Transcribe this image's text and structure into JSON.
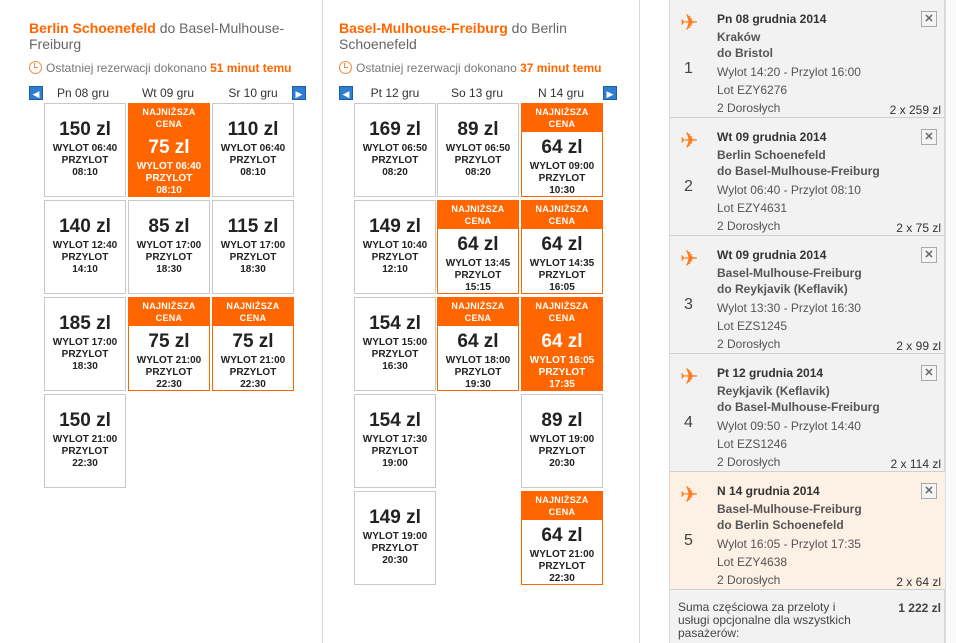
{
  "outbound": {
    "city": "Berlin Schoenefeld",
    "rest": " do Basel-Mulhouse-Freiburg",
    "booked_prefix": "Ostatniej rezerwacji dokonano ",
    "booked_mins": "51 minut temu",
    "prev_arrow": "◀",
    "next_arrow": "▶",
    "days": [
      "Pn 08 gru",
      "Wt 09 gru",
      "Sr 10 gru"
    ],
    "columns": [
      [
        {
          "price": "150 zl",
          "dep": "WYLOT 06:40",
          "arr_label": "PRZYLOT",
          "arr": "08:10"
        },
        {
          "price": "140 zl",
          "dep": "WYLOT 12:40",
          "arr_label": "PRZYLOT",
          "arr": "14:10"
        },
        {
          "price": "185 zl",
          "dep": "WYLOT 17:00",
          "arr_label": "PRZYLOT",
          "arr": "18:30"
        },
        {
          "price": "150 zl",
          "dep": "WYLOT 21:00",
          "arr_label": "PRZYLOT",
          "arr": "22:30"
        }
      ],
      [
        {
          "badge": "NAJNIŻSZA\nCENA",
          "price": "75 zl",
          "dep": "WYLOT 06:40",
          "arr_label": "PRZYLOT",
          "arr": "08:10"
        },
        {
          "price": "85 zl",
          "dep": "WYLOT 17:00",
          "arr_label": "PRZYLOT",
          "arr": "18:30"
        },
        {
          "badge": "NAJNIŻSZA\nCENA",
          "price": "75 zl",
          "dep": "WYLOT 21:00",
          "arr_label": "PRZYLOT",
          "arr": "22:30"
        }
      ],
      [
        {
          "price": "110 zl",
          "dep": "WYLOT 06:40",
          "arr_label": "PRZYLOT",
          "arr": "08:10"
        },
        {
          "price": "115 zl",
          "dep": "WYLOT 17:00",
          "arr_label": "PRZYLOT",
          "arr": "18:30"
        },
        {
          "badge": "NAJNIŻSZA\nCENA",
          "price": "75 zl",
          "dep": "WYLOT 21:00",
          "arr_label": "PRZYLOT",
          "arr": "22:30"
        }
      ]
    ]
  },
  "return": {
    "city": "Basel-Mulhouse-Freiburg",
    "rest": " do Berlin Schoenefeld",
    "booked_prefix": "Ostatniej rezerwacji dokonano ",
    "booked_mins": "37 minut temu",
    "prev_arrow": "◀",
    "next_arrow": "▶",
    "days": [
      "Pt 12 gru",
      "So 13 gru",
      "N 14 gru"
    ],
    "columns": [
      [
        {
          "price": "169 zl",
          "dep": "WYLOT 06:50",
          "arr_label": "PRZYLOT",
          "arr": "08:20"
        },
        {
          "price": "149 zl",
          "dep": "WYLOT 10:40",
          "arr_label": "PRZYLOT",
          "arr": "12:10"
        },
        {
          "price": "154 zl",
          "dep": "WYLOT 15:00",
          "arr_label": "PRZYLOT",
          "arr": "16:30"
        },
        {
          "price": "154 zl",
          "dep": "WYLOT 17:30",
          "arr_label": "PRZYLOT",
          "arr": "19:00"
        },
        {
          "price": "149 zl",
          "dep": "WYLOT 19:00",
          "arr_label": "PRZYLOT",
          "arr": "20:30"
        }
      ],
      [
        {
          "price": "89 zl",
          "dep": "WYLOT 06:50",
          "arr_label": "PRZYLOT",
          "arr": "08:20"
        },
        {
          "badge": "NAJNIŻSZA\nCENA",
          "price": "64 zl",
          "dep": "WYLOT 13:45",
          "arr_label": "PRZYLOT",
          "arr": "15:15"
        },
        {
          "badge": "NAJNIŻSZA\nCENA",
          "price": "64 zl",
          "dep": "WYLOT 18:00",
          "arr_label": "PRZYLOT",
          "arr": "19:30"
        }
      ],
      [
        {
          "badge": "NAJNIŻSZA\nCENA",
          "price": "64 zl",
          "dep": "WYLOT 09:00",
          "arr_label": "PRZYLOT",
          "arr": "10:30"
        },
        {
          "badge": "NAJNIŻSZA\nCENA",
          "price": "64 zl",
          "dep": "WYLOT 14:35",
          "arr_label": "PRZYLOT",
          "arr": "16:05"
        },
        {
          "badge": "NAJNIŻSZA\nCENA",
          "price": "64 zl",
          "dep": "WYLOT 16:05",
          "arr_label": "PRZYLOT",
          "arr": "17:35"
        },
        {
          "price": "89 zl",
          "dep": "WYLOT 19:00",
          "arr_label": "PRZYLOT",
          "arr": "20:30"
        },
        {
          "badge": "NAJNIŻSZA\nCENA",
          "price": "64 zl",
          "dep": "WYLOT 21:00",
          "arr_label": "PRZYLOT",
          "arr": "22:30"
        }
      ]
    ]
  },
  "basket": {
    "segments": [
      {
        "num": "1",
        "date": "Pn 08 grudnia 2014",
        "from": "Kraków",
        "to": "do Bristol",
        "times": "Wylot 14:20 - Przylot 16:00",
        "flight": "Lot EZY6276",
        "pax": "2 Dorosłych",
        "amount": "2 x 259 zl"
      },
      {
        "num": "2",
        "date": "Wt 09 grudnia 2014",
        "from": "Berlin Schoenefeld",
        "to": "do Basel-Mulhouse-Freiburg",
        "times": "Wylot 06:40 - Przylot 08:10",
        "flight": "Lot EZY4631",
        "pax": "2 Dorosłych",
        "amount": "2 x 75 zl"
      },
      {
        "num": "3",
        "date": "Wt 09 grudnia 2014",
        "from": "Basel-Mulhouse-Freiburg",
        "to": "do Reykjavik (Keflavik)",
        "times": "Wylot 13:30 - Przylot 16:30",
        "flight": "Lot EZS1245",
        "pax": "2 Dorosłych",
        "amount": "2 x 99 zl"
      },
      {
        "num": "4",
        "date": "Pt 12 grudnia 2014",
        "from": "Reykjavik (Keflavik)",
        "to": "do Basel-Mulhouse-Freiburg",
        "times": "Wylot 09:50 - Przylot 14:40",
        "flight": "Lot EZS1246",
        "pax": "2 Dorosłych",
        "amount": "2 x 114 zl"
      },
      {
        "num": "5",
        "date": "N 14 grudnia 2014",
        "from": "Basel-Mulhouse-Freiburg",
        "to": "do Berlin Schoenefeld",
        "times": "Wylot 16:05 - Przylot 17:35",
        "flight": "Lot EZY4638",
        "pax": "2 Dorosłych",
        "amount": "2 x 64 zl"
      }
    ],
    "close_glyph": "✕",
    "summary_label": "Suma częściowa za przeloty i usługi opcjonalne dla wszystkich pasażerów:",
    "summary_total": "1 222 zl"
  }
}
